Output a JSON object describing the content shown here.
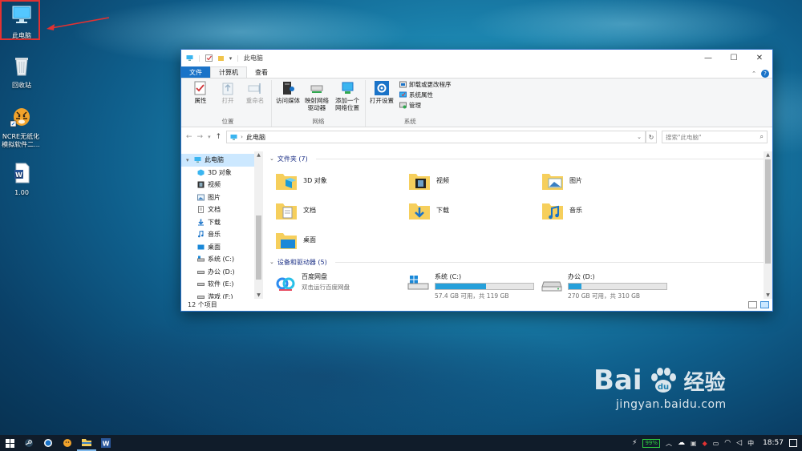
{
  "desktop": {
    "icons": [
      {
        "label": "此电脑",
        "icon": "this-pc-icon"
      },
      {
        "label": "回收站",
        "icon": "recycle-bin-icon"
      },
      {
        "label": "NCRE无纸化模拟软件二...",
        "icon": "tiger-app-icon"
      },
      {
        "label": "1.00",
        "icon": "word-document-icon"
      }
    ]
  },
  "window": {
    "title": "此电脑",
    "controls": {
      "minimize": "—",
      "maximize": "☐",
      "close": "✕"
    },
    "tabs": [
      {
        "label": "文件"
      },
      {
        "label": "计算机"
      },
      {
        "label": "查看"
      }
    ],
    "ribbon": {
      "groups": [
        {
          "name": "位置",
          "buttons": [
            "属性",
            "打开",
            "重命名"
          ]
        },
        {
          "name": "网络",
          "buttons": [
            "访问媒体",
            "映射网络驱动器",
            "添加一个网络位置"
          ]
        },
        {
          "name": "系统",
          "buttons": [
            "打开设置"
          ],
          "small": [
            "卸载或更改程序",
            "系统属性",
            "管理"
          ]
        }
      ]
    },
    "address": {
      "path": "此电脑",
      "search_placeholder": "搜索\"此电脑\""
    },
    "nav": {
      "root": "此电脑",
      "items": [
        "3D 对象",
        "视频",
        "图片",
        "文档",
        "下载",
        "音乐",
        "桌面",
        "系统 (C:)",
        "办公 (D:)",
        "软件 (E:)",
        "游戏 (F:)"
      ]
    },
    "folders_header": "文件夹 (7)",
    "folders": [
      "3D 对象",
      "视频",
      "图片",
      "文档",
      "下载",
      "音乐",
      "桌面"
    ],
    "devices_header": "设备和驱动器 (5)",
    "devices": [
      {
        "name": "百度网盘",
        "sub": "双击运行百度网盘",
        "icon": "baidu-netdisk-icon"
      },
      {
        "name": "系统 (C:)",
        "sub": "57.4 GB 可用，共 119 GB",
        "used_fraction": 0.52,
        "icon": "windows-drive-icon"
      },
      {
        "name": "办公 (D:)",
        "sub": "270 GB 可用，共 310 GB",
        "used_fraction": 0.13,
        "icon": "hdd-drive-icon"
      }
    ],
    "status": "12 个项目"
  },
  "watermark": {
    "brand": "Bai",
    "brand2": "经验",
    "url": "jingyan.baidu.com"
  },
  "taskbar": {
    "battery": "99%",
    "time": "18:57"
  },
  "colors": {
    "accent": "#1a73c8",
    "drive_fill": "#26a0da",
    "highlight": "#e23232"
  }
}
